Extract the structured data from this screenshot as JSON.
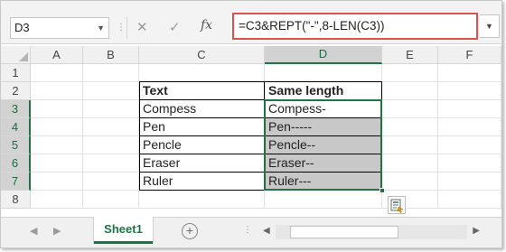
{
  "formula_bar": {
    "name_box": "D3",
    "formula": "=C3&REPT(\"-\",8-LEN(C3))",
    "fx_label": "fx",
    "cancel_glyph": "✕",
    "enter_glyph": "✓"
  },
  "columns": [
    "A",
    "B",
    "C",
    "D",
    "E",
    "F"
  ],
  "rows": [
    "1",
    "2",
    "3",
    "4",
    "5",
    "6",
    "7",
    "8"
  ],
  "selected_column": "D",
  "selected_rows": [
    "3",
    "4",
    "5",
    "6",
    "7"
  ],
  "table": {
    "headers": [
      "Text",
      "Same length"
    ],
    "rows": [
      [
        "Compess",
        "Compess-"
      ],
      [
        "Pen",
        "Pen-----"
      ],
      [
        "Pencle",
        "Pencle--"
      ],
      [
        "Eraser",
        "Eraser--"
      ],
      [
        "Ruler",
        "Ruler---"
      ]
    ]
  },
  "sheet_tab": "Sheet1",
  "colors": {
    "accent": "#217346",
    "formula_border": "#d9534f",
    "selection_fill": "#c8c8c8"
  },
  "icons": [
    "quick-analysis-icon",
    "add-sheet-icon",
    "name-box-dropdown-icon",
    "expand-formula-bar-icon"
  ]
}
